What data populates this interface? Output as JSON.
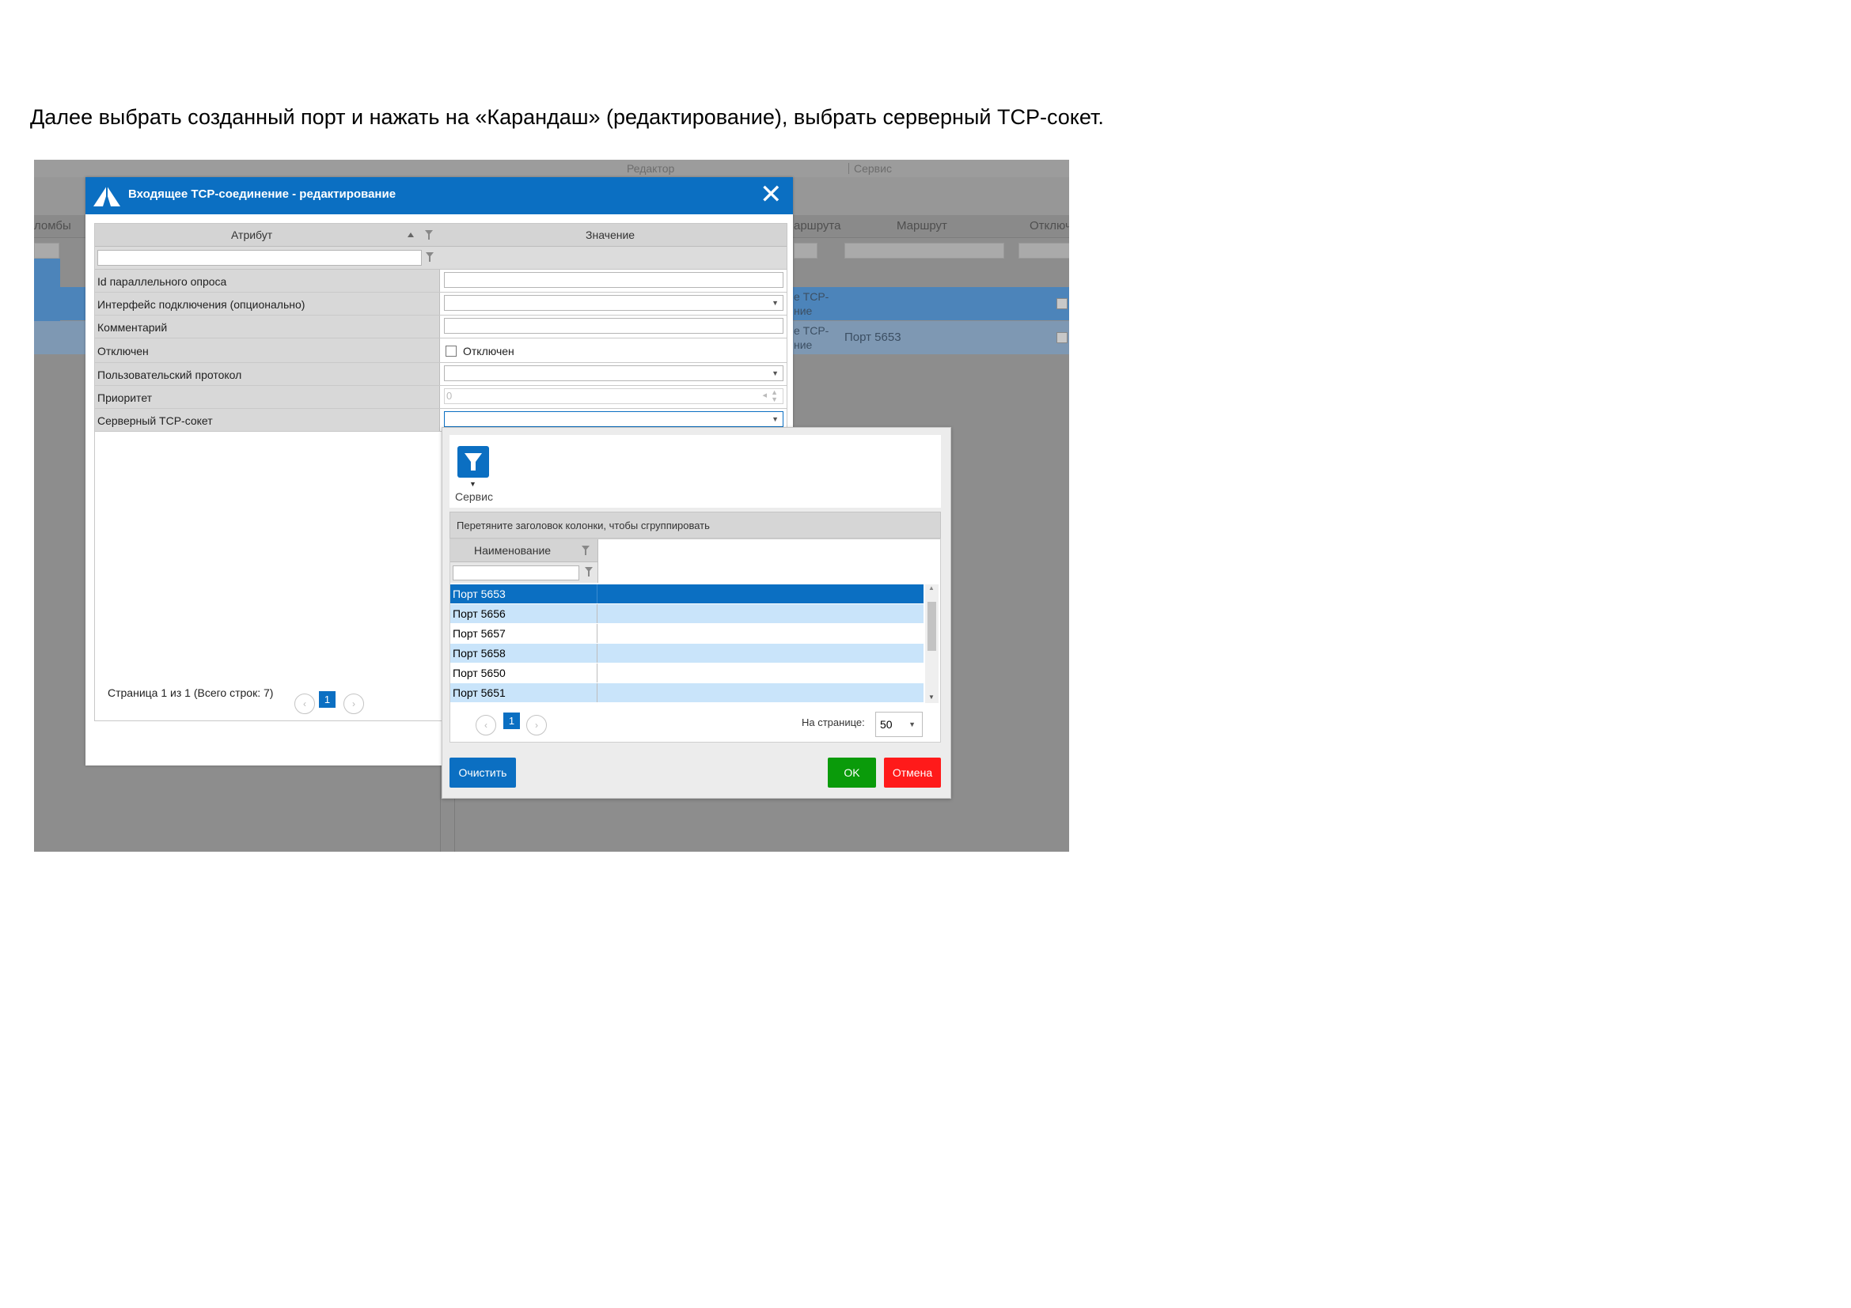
{
  "instruction": "Далее выбрать созданный порт и нажать на «Карандаш» (редактирование), выбрать серверный  TCP-сокет.",
  "background_app": {
    "menu": [
      "Редактор",
      "Сервис"
    ],
    "columns": [
      "ломбы",
      "аршрута",
      "Маршрут",
      "Отключ"
    ],
    "row_a_cell": "е TCP-\nние",
    "row_b_cell": "е TCP-\nние",
    "row_b_route": "Порт 5653"
  },
  "dialog": {
    "title": "Входящее TCP-соединение - редактирование",
    "close_glyph": "✕",
    "grid_headers": {
      "attribute": "Атрибут",
      "value": "Значение"
    },
    "properties": [
      {
        "label": "Id параллельного опроса",
        "type": "text",
        "value": ""
      },
      {
        "label": "Интерфейс подключения (опционально)",
        "type": "dropdown",
        "value": ""
      },
      {
        "label": "Комментарий",
        "type": "text",
        "value": ""
      },
      {
        "label": "Отключен",
        "type": "checkbox",
        "value": "Отключен",
        "checked": false
      },
      {
        "label": "Пользовательский протокол",
        "type": "dropdown",
        "value": ""
      },
      {
        "label": "Приоритет",
        "type": "spinner",
        "value": "0"
      },
      {
        "label": "Серверный TCP-сокет",
        "type": "dropdown",
        "value": ""
      }
    ],
    "footer_text": "Страница 1 из 1 (Всего строк: 7)",
    "page_number": "1",
    "prev_glyph": "‹",
    "next_glyph": "›"
  },
  "popup": {
    "toolbar_button_label": "Сервис",
    "toolbar_icon": "filter-icon",
    "group_hint": "Перетяните заголовок колонки, чтобы сгруппировать",
    "column_header": "Наименование",
    "items": [
      {
        "label": "Порт 5653",
        "state": "selected"
      },
      {
        "label": "Порт 5656",
        "state": "alt"
      },
      {
        "label": "Порт 5657",
        "state": "normal"
      },
      {
        "label": "Порт 5658",
        "state": "alt"
      },
      {
        "label": "Порт 5650",
        "state": "normal"
      },
      {
        "label": "Порт 5651",
        "state": "alt"
      }
    ],
    "page_number": "1",
    "per_page_label": "На странице:",
    "per_page_value": "50",
    "clear_label": "Очистить",
    "ok_label": "OK",
    "cancel_label": "Отмена",
    "colors": {
      "accent": "#0b6fc2",
      "selected_row": "#0b6fc2",
      "alt_row": "#c9e4fa",
      "ok": "#0a9b0a",
      "cancel": "#ff1a1a"
    }
  }
}
